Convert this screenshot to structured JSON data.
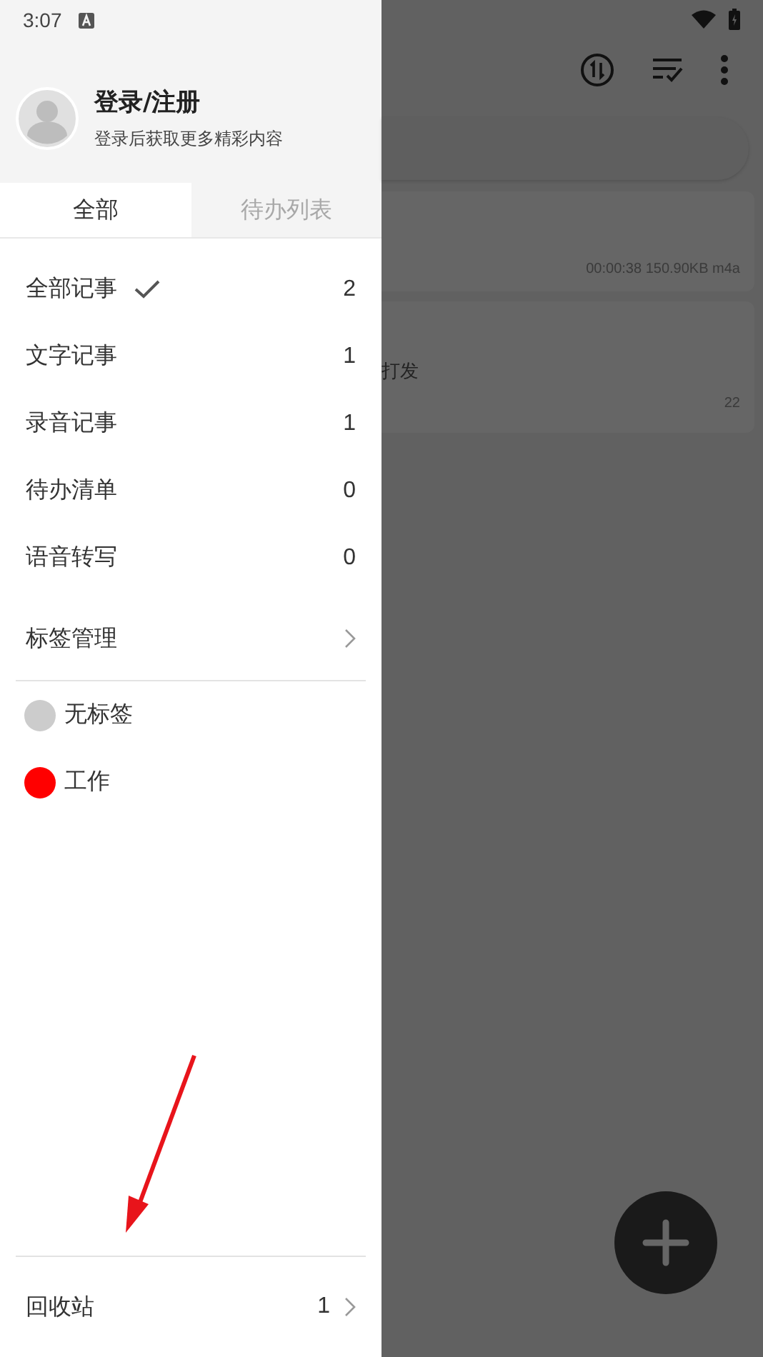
{
  "status_bar": {
    "time": "3:07"
  },
  "profile": {
    "title": "登录/注册",
    "subtitle": "登录后获取更多精彩内容"
  },
  "tabs": [
    {
      "label": "全部",
      "selected": true
    },
    {
      "label": "待办列表",
      "selected": false
    }
  ],
  "categories": [
    {
      "label": "全部记事",
      "count": "2",
      "checked": true
    },
    {
      "label": "文字记事",
      "count": "1",
      "checked": false
    },
    {
      "label": "录音记事",
      "count": "1",
      "checked": false
    },
    {
      "label": "待办清单",
      "count": "0",
      "checked": false
    },
    {
      "label": "语音转写",
      "count": "0",
      "checked": false
    }
  ],
  "tag_manage": {
    "label": "标签管理"
  },
  "tags": [
    {
      "label": "无标签",
      "color": "#cccccc"
    },
    {
      "label": "工作",
      "color": "#ff0000"
    }
  ],
  "trash": {
    "label": "回收站",
    "count": "1"
  },
  "notes": [
    {
      "meta": "00:00:38 150.90KB m4a"
    },
    {
      "text": "打发",
      "meta": "22"
    }
  ]
}
